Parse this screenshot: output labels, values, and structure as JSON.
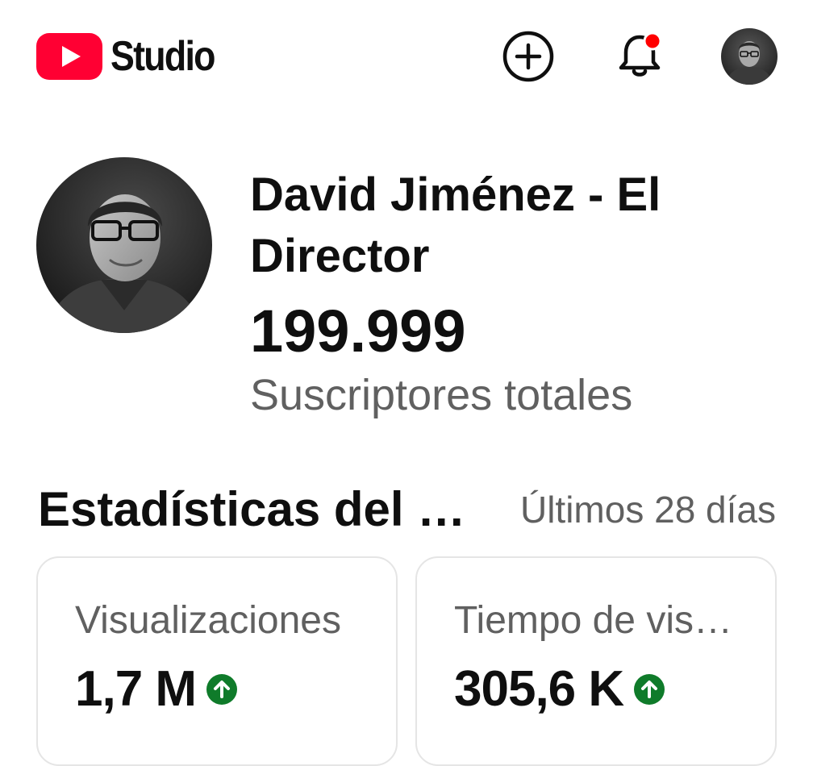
{
  "app": {
    "logo_text": "Studio",
    "brand_color": "#ff0033"
  },
  "header": {
    "icons": [
      "create-icon",
      "bell-icon",
      "avatar"
    ],
    "notification_badge_color": "#ff0000"
  },
  "channel": {
    "name": "David Jiménez - El Director",
    "subscriber_count": "199.999",
    "subscriber_label": "Suscriptores totales"
  },
  "stats": {
    "title": "Estadísticas del canal",
    "period": "Últimos 28 días",
    "cards": [
      {
        "label": "Visualizaciones",
        "value": "1,7 M",
        "trend": "up"
      },
      {
        "label": "Tiempo de visualización (horas)",
        "value": "305,6 K",
        "trend": "up"
      }
    ],
    "trend_up_color": "#0f7b2a"
  }
}
